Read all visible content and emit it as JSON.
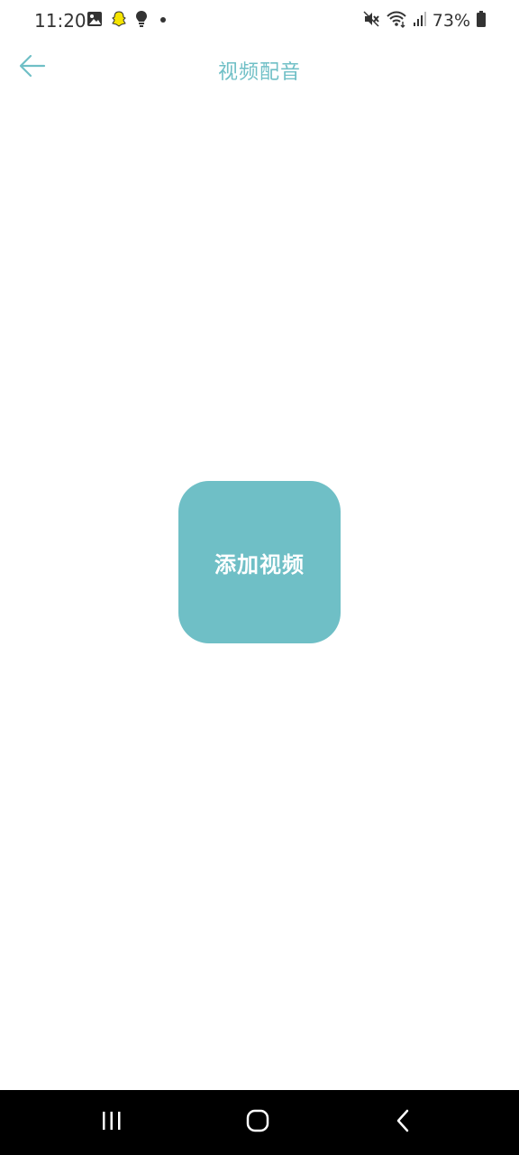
{
  "status_bar": {
    "time": "11:20",
    "battery_percent": "73%",
    "left_icons": [
      "gallery-icon",
      "snapchat-icon",
      "lightbulb-icon",
      "dot-icon"
    ],
    "right_icons": [
      "mute-icon",
      "wifi-icon",
      "signal-icon",
      "battery-icon"
    ]
  },
  "header": {
    "title": "视频配音",
    "back_icon": "arrow-left-icon"
  },
  "main": {
    "add_video_label": "添加视频"
  },
  "nav_bar": {
    "buttons": [
      "recent-apps-icon",
      "home-icon",
      "back-icon"
    ]
  },
  "colors": {
    "accent": "#6fbfc6",
    "status_text": "#333333",
    "nav_bg": "#000000"
  }
}
